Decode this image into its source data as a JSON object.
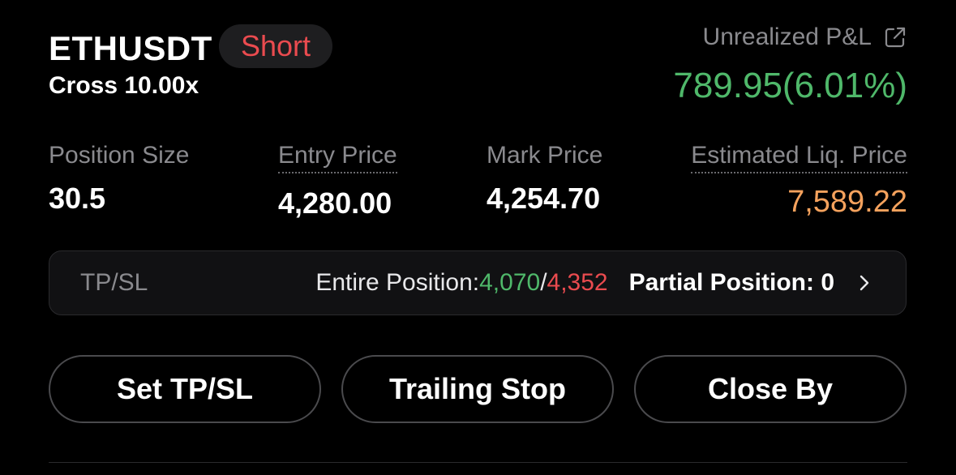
{
  "position": {
    "symbol": "ETHUSDT",
    "side": "Short",
    "margin_mode": "Cross 10.00x"
  },
  "pnl": {
    "label": "Unrealized P&L",
    "value": "789.95(6.01%)",
    "icon": "external-link-icon"
  },
  "stats": {
    "position_size": {
      "label": "Position Size",
      "value": "30.5"
    },
    "entry_price": {
      "label": "Entry Price",
      "value": "4,280.00"
    },
    "mark_price": {
      "label": "Mark Price",
      "value": "4,254.70"
    },
    "liq_price": {
      "label": "Estimated Liq. Price",
      "value": "7,589.22"
    }
  },
  "tpsl": {
    "title": "TP/SL",
    "entire_label": "Entire Position: ",
    "tp": "4,070",
    "separator": "/",
    "sl": "4,352",
    "partial_label": "Partial Position: 0",
    "icon": "chevron-right-icon"
  },
  "actions": {
    "set_tpsl": "Set TP/SL",
    "trailing_stop": "Trailing Stop",
    "close_by": "Close By"
  },
  "colors": {
    "profit": "#4fb86a",
    "loss": "#ea4b4f",
    "liq": "#f5a25d",
    "muted": "#8a8a8e"
  }
}
